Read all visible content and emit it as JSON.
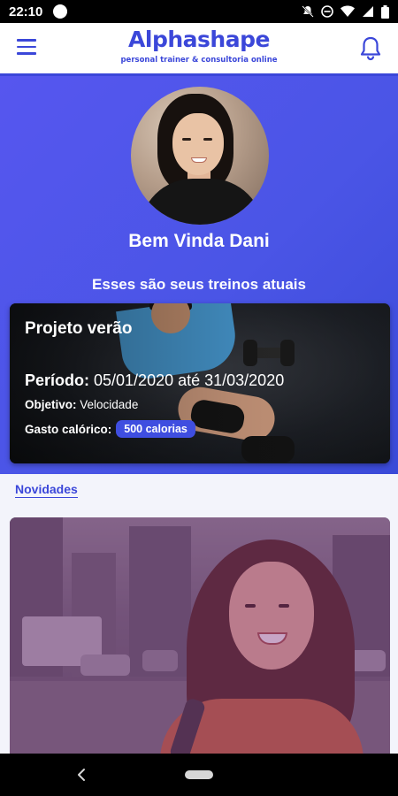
{
  "status_bar": {
    "time": "22:10"
  },
  "app_bar": {
    "brand_title": "Alphashape",
    "brand_subtitle": "personal trainer & consultoria online",
    "menu_icon": "hamburger-menu-icon",
    "notification_icon": "bell-icon"
  },
  "hero": {
    "welcome": "Bem Vinda Dani",
    "subtitle": "Esses são seus treinos atuais"
  },
  "workout": {
    "title": "Projeto verão",
    "period_label": "Período:",
    "period_value": " 05/01/2020 até 31/03/2020",
    "objective_label": "Objetivo:",
    "objective_value": " Velocidade",
    "calories_label": "Gasto calórico:",
    "calories_value": "500 calorias"
  },
  "news": {
    "label": "Novidades"
  },
  "colors": {
    "primary": "#3b47d9",
    "hero_gradient_start": "#5656ef",
    "hero_gradient_end": "#3a4ad8",
    "badge": "#3f4ee0",
    "news_overlay": "#7a2876"
  },
  "nav_bar": {
    "back_icon": "back-triangle-icon",
    "home_icon": "home-pill-icon"
  }
}
